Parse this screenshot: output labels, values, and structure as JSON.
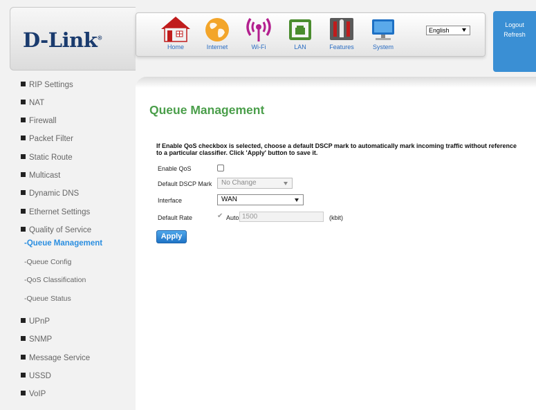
{
  "brand": {
    "logo_text": "D-Link",
    "logo_mark": "®"
  },
  "nav": {
    "items": [
      {
        "label": "Home",
        "icon": "home-icon"
      },
      {
        "label": "Internet",
        "icon": "globe-icon"
      },
      {
        "label": "Wi-Fi",
        "icon": "wifi-icon"
      },
      {
        "label": "LAN",
        "icon": "lan-icon"
      },
      {
        "label": "Features",
        "icon": "tools-icon"
      },
      {
        "label": "System",
        "icon": "monitor-icon"
      }
    ]
  },
  "language": {
    "selected": "English"
  },
  "user": {
    "logout": "Logout",
    "refresh": "Refresh"
  },
  "sidebar": {
    "items": [
      "RIP Settings",
      "NAT",
      "Firewall",
      "Packet Filter",
      "Static Route",
      "Multicast",
      "Dynamic DNS",
      "Ethernet Settings",
      "Quality of Service"
    ],
    "sub_items": [
      "-Queue Management",
      "-Queue Config",
      "-QoS Classification",
      "-Queue Status"
    ],
    "items_after": [
      "UPnP",
      "SNMP",
      "Message Service",
      "USSD",
      "VoIP"
    ]
  },
  "page": {
    "title": "Queue Management",
    "description": "If Enable QoS checkbox is selected, choose a default DSCP mark to automatically mark incoming traffic without reference to a particular classifier. Click 'Apply' button to save it.",
    "enable_qos_label": "Enable QoS",
    "dscp_label": "Default DSCP Mark",
    "dscp_value": "No Change",
    "interface_label": "Interface",
    "interface_value": "WAN",
    "rate_label": "Default Rate",
    "auto_label": "Auto",
    "rate_value": "1500",
    "rate_unit": "(kbit)",
    "apply": "Apply"
  },
  "colors": {
    "accent": "#2a8ee0",
    "title": "#4a9e4a",
    "logo": "#1a3b6e",
    "button": "#2a80d0"
  }
}
